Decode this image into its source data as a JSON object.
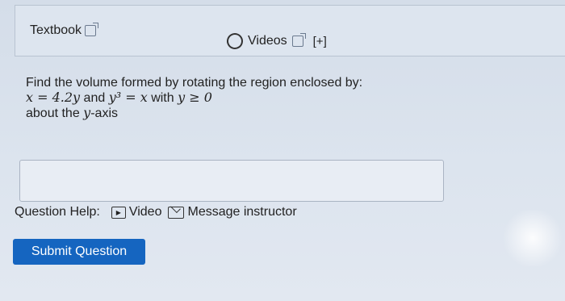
{
  "resources": {
    "textbook_label": "Textbook",
    "videos_label": "Videos",
    "expand_label": "[+]"
  },
  "question": {
    "line1": "Find the volume formed by rotating the region enclosed by:",
    "eq1": "x = 4.2y",
    "and": " and ",
    "eq2": "y³ = x",
    "with": " with ",
    "eq3": "y ≥ 0",
    "line3_prefix": "about the ",
    "axis": "y",
    "line3_suffix": "-axis"
  },
  "answer": {
    "value": ""
  },
  "help": {
    "label": "Question Help:",
    "video_label": "Video",
    "message_label": "Message instructor"
  },
  "submit_label": "Submit Question"
}
